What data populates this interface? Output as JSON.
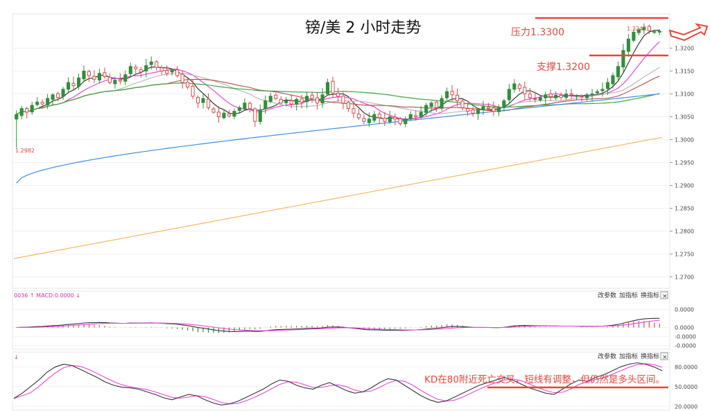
{
  "title": "镑/美  2 小时走势",
  "colors": {
    "up": "#2f8f3a",
    "down": "#d84a4a",
    "ma1": "#333333",
    "ma2": "#ee44dd",
    "ma3": "#b8b8b8",
    "ma4": "#b55a5a",
    "ma5": "#3fa33f",
    "ma6": "#3d8fe0",
    "ma7": "#f4b860",
    "annot": "#e8453c",
    "macd_dif": "#333333",
    "macd_dea": "#ee44dd"
  },
  "annotations": {
    "resistance_label": "压力1.3300",
    "support_label": "支撑1.3200",
    "low_label": "1.2982",
    "high_label": "1.3247",
    "kd_comment": "KD在80附近死亡交叉，短线有调整，但仍然是多头区间。"
  },
  "panels": {
    "macd_info": "0036 ↑ MACD:0.0000 ↓",
    "kd_info": "↓",
    "buttons": [
      "改参数",
      "加指标",
      "换指标"
    ],
    "close": "×"
  },
  "chart_data": [
    {
      "type": "candlestick",
      "ylim": [
        1.2675,
        1.3275
      ],
      "yticks": [
        "1.3200",
        "1.3150",
        "1.3100",
        "1.3050",
        "1.3000",
        "1.2950",
        "1.2900",
        "1.2850",
        "1.2800",
        "1.2750",
        "1.2700"
      ],
      "resistance": 1.33,
      "support": 1.32,
      "low": 1.2982,
      "high": 1.3247,
      "closes": [
        1.3055,
        1.3068,
        1.306,
        1.3075,
        1.3082,
        1.3078,
        1.309,
        1.3098,
        1.3092,
        1.311,
        1.3125,
        1.3118,
        1.3135,
        1.315,
        1.314,
        1.3132,
        1.3145,
        1.3138,
        1.3125,
        1.313,
        1.3128,
        1.3142,
        1.316,
        1.3155,
        1.3148,
        1.3162,
        1.317,
        1.3158,
        1.315,
        1.3145,
        1.3152,
        1.314,
        1.3125,
        1.3115,
        1.3095,
        1.308,
        1.309,
        1.307,
        1.306,
        1.305,
        1.3058,
        1.3052,
        1.3062,
        1.307,
        1.308,
        1.3068,
        1.304,
        1.3065,
        1.3085,
        1.3095,
        1.309,
        1.308,
        1.3085,
        1.3078,
        1.3088,
        1.3082,
        1.3095,
        1.309,
        1.308,
        1.3098,
        1.3125,
        1.3102,
        1.3095,
        1.308,
        1.3068,
        1.3058,
        1.3048,
        1.304,
        1.3045,
        1.3055,
        1.3048,
        1.304,
        1.305,
        1.3045,
        1.3035,
        1.3045,
        1.3055,
        1.305,
        1.306,
        1.3075,
        1.308,
        1.307,
        1.309,
        1.3105,
        1.3098,
        1.3085,
        1.307,
        1.3062,
        1.3058,
        1.3065,
        1.3072,
        1.3068,
        1.3062,
        1.307,
        1.3085,
        1.311,
        1.3122,
        1.3112,
        1.31,
        1.3092,
        1.3088,
        1.3092,
        1.3098,
        1.3094,
        1.3097,
        1.3092,
        1.31,
        1.3098,
        1.3096,
        1.3094,
        1.3098,
        1.31,
        1.3105,
        1.311,
        1.3125,
        1.314,
        1.316,
        1.3195,
        1.322,
        1.3235,
        1.324,
        1.3245,
        1.3238,
        1.3236,
        1.3237
      ]
    },
    {
      "type": "bar",
      "name": "MACD",
      "ylim": [
        -0.009,
        0.013
      ],
      "yticks": [
        "0.0000",
        "0.0000",
        "-0.0000",
        "-0.0000"
      ]
    },
    {
      "type": "line",
      "name": "KD",
      "ylim": [
        15,
        95
      ],
      "yticks": [
        "80.0000",
        "50.0000",
        "20.0000"
      ],
      "k": [
        32,
        40,
        50,
        60,
        72,
        80,
        84,
        82,
        76,
        70,
        64,
        57,
        52,
        49,
        48,
        46,
        42,
        38,
        33,
        30,
        34,
        38,
        36,
        30,
        25,
        22,
        24,
        28,
        34,
        40,
        46,
        54,
        60,
        58,
        52,
        48,
        46,
        52,
        56,
        50,
        44,
        40,
        42,
        48,
        56,
        62,
        60,
        52,
        44,
        36,
        30,
        26,
        28,
        34,
        40,
        46,
        52,
        56,
        60,
        64,
        60,
        54,
        48,
        44,
        40,
        38,
        46,
        54,
        60,
        58,
        64,
        68,
        74,
        80,
        84,
        86,
        84,
        80,
        74
      ]
    }
  ]
}
